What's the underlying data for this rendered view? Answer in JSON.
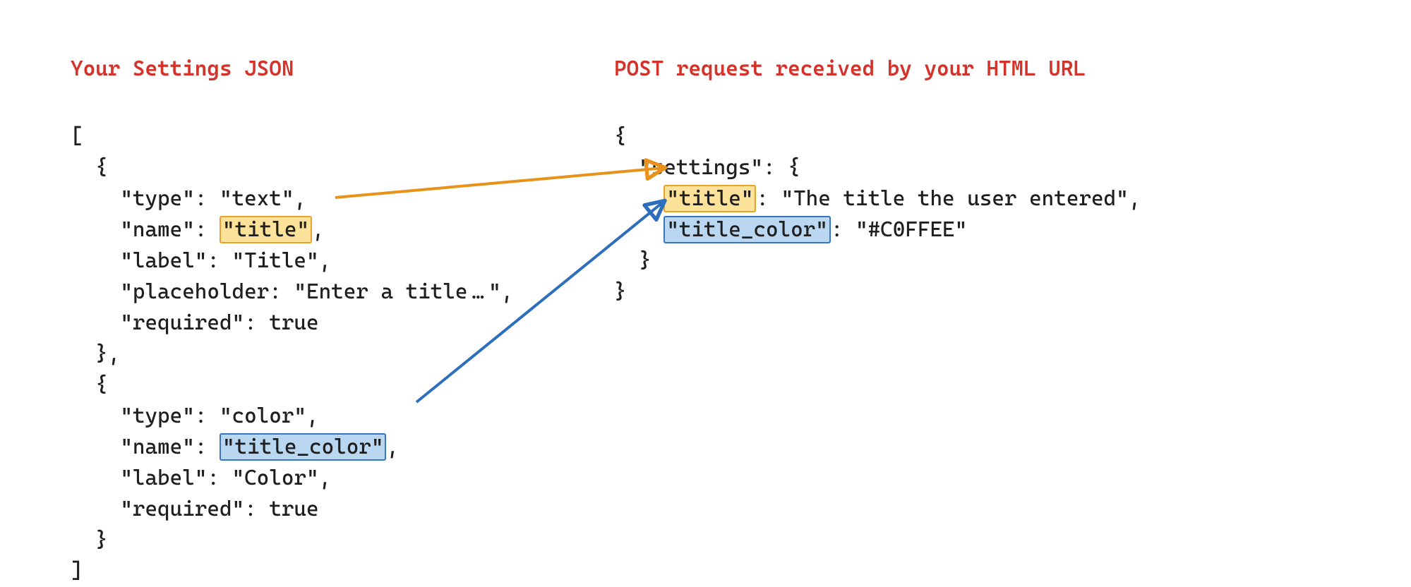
{
  "headings": {
    "left": "Your Settings JSON",
    "right": "POST request received by your HTML URL"
  },
  "left_code": {
    "l1": "[",
    "l2": "  {",
    "l3": "    \"type\": \"text\",",
    "l4a": "    \"name\": ",
    "l4b": "\"title\"",
    "l4c": ",",
    "l5": "    \"label\": \"Title\",",
    "l6": "    \"placeholder: \"Enter a title … \",",
    "l7": "    \"required\": true",
    "l8": "  },",
    "l9": "  {",
    "l10": "    \"type\": \"color\",",
    "l11a": "    \"name\": ",
    "l11b": "\"title_color\"",
    "l11c": ",",
    "l12": "    \"label\": \"Color\",",
    "l13": "    \"required\": true",
    "l14": "  }",
    "l15": "]"
  },
  "right_code": {
    "l1": "{",
    "l2": "  \"settings\": {",
    "l3a": "    ",
    "l3b": "\"title\"",
    "l3c": ": \"The title the user entered\",",
    "l4a": "    ",
    "l4b": "\"title_color\"",
    "l4c": ": \"#C0FFEE\"",
    "l5": "  }",
    "l6": "}"
  },
  "arrows": {
    "orange": {
      "from": "title (settings JSON)",
      "to": "title (POST body)"
    },
    "blue": {
      "from": "title_color (settings JSON)",
      "to": "title_color (POST body)"
    }
  }
}
